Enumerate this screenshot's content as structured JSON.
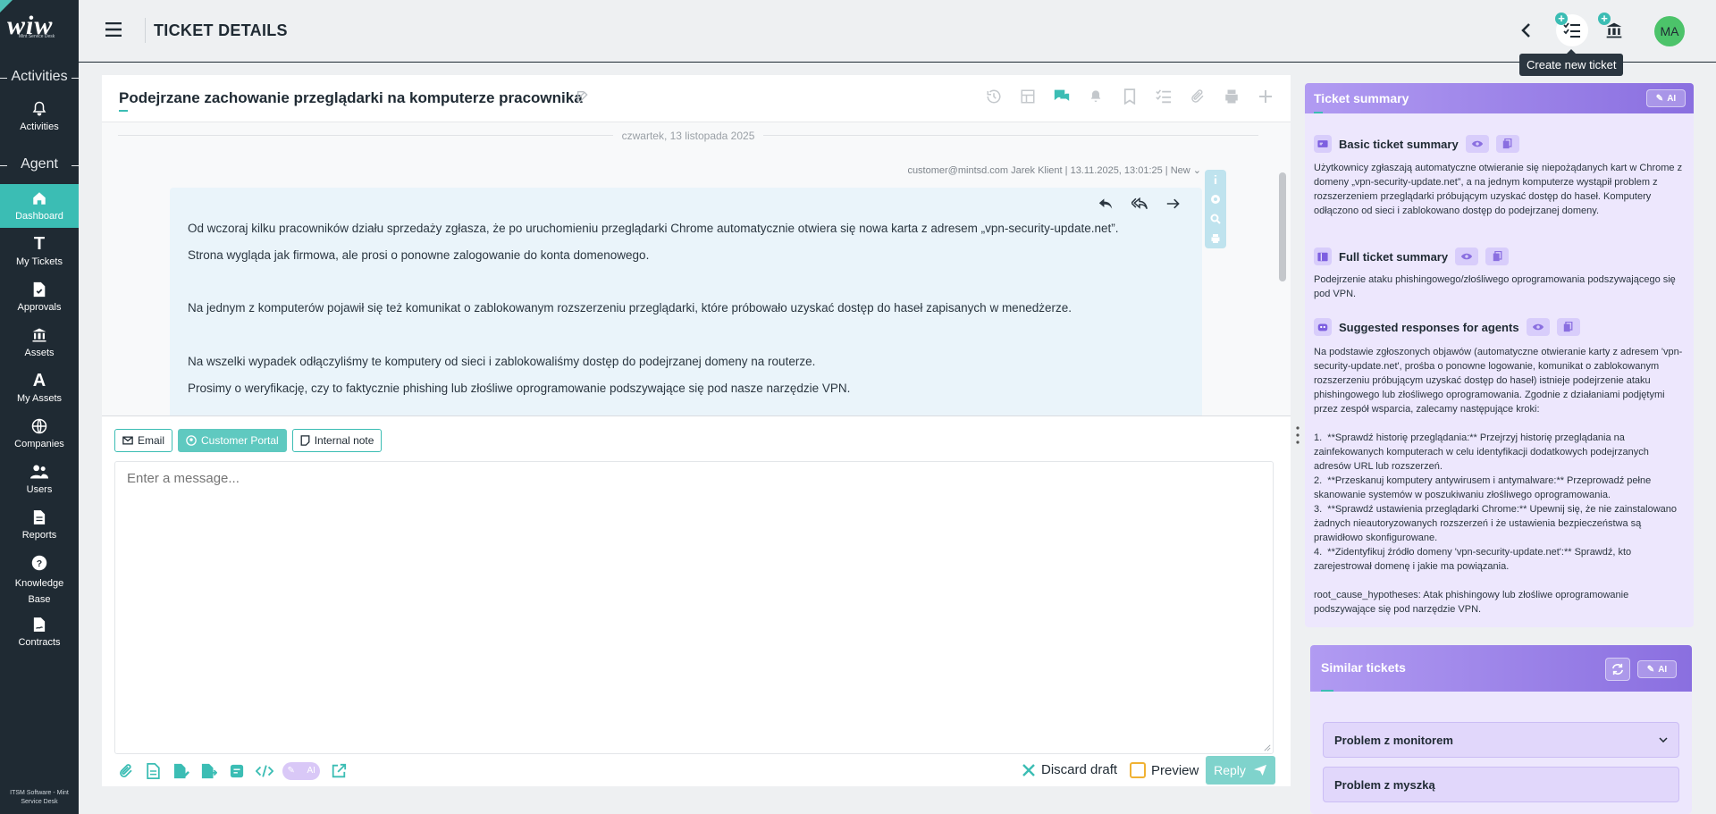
{
  "sidebar": {
    "logo_sub": "Mint Service Desk",
    "sections": {
      "activities": "Activities",
      "agent": "Agent"
    },
    "items": [
      {
        "label": "Activities"
      },
      {
        "label": "Dashboard"
      },
      {
        "label": "My Tickets"
      },
      {
        "label": "Approvals"
      },
      {
        "label": "Assets"
      },
      {
        "label": "My Assets"
      },
      {
        "label": "Companies"
      },
      {
        "label": "Users"
      },
      {
        "label": "Reports"
      },
      {
        "label": "Knowledge Base"
      },
      {
        "label": "Contracts"
      }
    ],
    "footer": "ITSM Software - Mint Service Desk"
  },
  "header": {
    "title": "TICKET DETAILS",
    "avatar": "MA",
    "tooltip": "Create new ticket"
  },
  "ticket": {
    "title": "Podejrzane zachowanie przeglądarki na komputerze pracownika",
    "date_separator": "czwartek, 13 listopada 2025",
    "meta": "customer@mintsd.com Jarek Klient  | 13.11.2025, 13:01:25  | New",
    "message": [
      "Od wczoraj kilku pracowników działu sprzedaży zgłasza, że po uruchomieniu przeglądarki Chrome automatycznie otwiera się nowa karta z adresem „vpn-security-update.net”.",
      "Strona wygląda jak firmowa, ale prosi o ponowne zalogowanie do konta domenowego.",
      "Na jednym z komputerów pojawił się też komunikat o zablokowanym rozszerzeniu przeglądarki, które próbowało uzyskać dostęp do haseł zapisanych w menedżerze.",
      "Na wszelki wypadek odłączyliśmy te komputery od sieci i zablokowaliśmy dostęp do podejrzanej domeny na routerze.",
      "Prosimy o weryfikację, czy to faktycznie phishing lub złośliwe oprogramowanie podszywające się pod nasze narzędzie VPN."
    ]
  },
  "composer": {
    "tabs": [
      "Email",
      "Customer Portal",
      "Internal note"
    ],
    "placeholder": "Enter a message...",
    "ai_label": "AI",
    "discard_label": "Discard draft",
    "preview_label": "Preview",
    "reply_label": "Reply"
  },
  "summary": {
    "title": "Ticket summary",
    "ai_label": "AI",
    "basic_title": "Basic ticket summary",
    "basic_text": "Użytkownicy zgłaszają automatyczne otwieranie się niepożądanych kart w Chrome z domeny „vpn-security-update.net”, a na jednym komputerze wystąpił problem z rozszerzeniem przeglądarki próbującym uzyskać dostęp do haseł. Komputery odłączono od sieci i zablokowano dostęp do podejrzanej domeny.",
    "full_title": "Full ticket summary",
    "full_text": "Podejrzenie ataku phishingowego/złośliwego oprogramowania podszywającego się pod VPN.",
    "responses_title": "Suggested responses for agents",
    "responses_text": "Na podstawie zgłoszonych objawów (automatyczne otwieranie karty z adresem 'vpn-security-update.net', prośba o ponowne logowanie, komunikat o zablokowanym rozszerzeniu próbującym uzyskać dostęp do haseł) istnieje podejrzenie ataku phishingowego lub złośliwego oprogramowania. Zgodnie z działaniami podjętymi przez zespół wsparcia, zalecamy następujące kroki:\n\n1.  **Sprawdź historię przeglądania:** Przejrzyj historię przeglądania na zainfekowanych komputerach w celu identyfikacji dodatkowych podejrzanych adresów URL lub rozszerzeń.\n2.  **Przeskanuj komputery antywirusem i antymalware:** Przeprowadź pełne skanowanie systemów w poszukiwaniu złośliwego oprogramowania.\n3.  **Sprawdź ustawienia przeglądarki Chrome:** Upewnij się, że nie zainstalowano żadnych nieautoryzowanych rozszerzeń i że ustawienia bezpieczeństwa są prawidłowo skonfigurowane.\n4.  **Zidentyfikuj źródło domeny 'vpn-security-update.net':** Sprawdź, kto zarejestrował domenę i jakie ma powiązania.\n\nroot_cause_hypotheses: Atak phishingowy lub złośliwe oprogramowanie podszywające się pod narzędzie VPN."
  },
  "similar": {
    "title": "Similar tickets",
    "ai_label": "AI",
    "items": [
      "Problem z monitorem",
      "Problem z myszką"
    ]
  },
  "colors": {
    "sidebar": "#1f2a33",
    "accent": "#3bbdb4",
    "ai_purple": "#8a6fe0"
  }
}
